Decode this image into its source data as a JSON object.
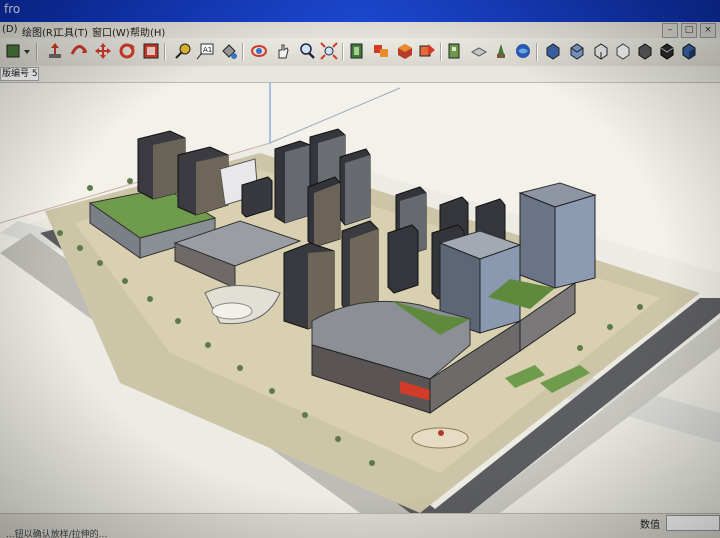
{
  "window": {
    "title": "fro"
  },
  "menubar": {
    "items": [
      {
        "label": "(D)",
        "name": "menu-view"
      },
      {
        "label": "绘图(R)",
        "name": "menu-draw"
      },
      {
        "label": "工具(T)",
        "name": "menu-tools"
      },
      {
        "label": "窗口(W)",
        "name": "menu-window"
      },
      {
        "label": "帮助(H)",
        "name": "menu-help"
      }
    ]
  },
  "layerbar": {
    "current_layer": "版编号 5"
  },
  "statusbar": {
    "measure_label": "数值",
    "hint": "...钮以确认放样/拉伸的..."
  },
  "colors": {
    "titlebar": "#1d49d6",
    "accent_red": "#d23a2a",
    "grass": "#6e9b4c"
  },
  "toolbar": {
    "icons": [
      "paint-bucket-icon",
      "dropdown-icon",
      "move-icon",
      "push-pull-icon",
      "rotate-icon",
      "follow-me-icon",
      "scale-icon",
      "tape-measure-icon",
      "text-icon",
      "paint-icon",
      "orbit-icon",
      "pan-icon",
      "zoom-icon",
      "zoom-extents-icon",
      "section-plane-icon",
      "components-icon",
      "warehouse-icon",
      "share-icon",
      "sandbox-icon",
      "iso-view-icon",
      "top-view-icon",
      "front-view-icon",
      "right-view-icon",
      "back-view-icon",
      "left-view-icon",
      "xray-icon",
      "wireframe-icon",
      "shaded-icon"
    ]
  }
}
